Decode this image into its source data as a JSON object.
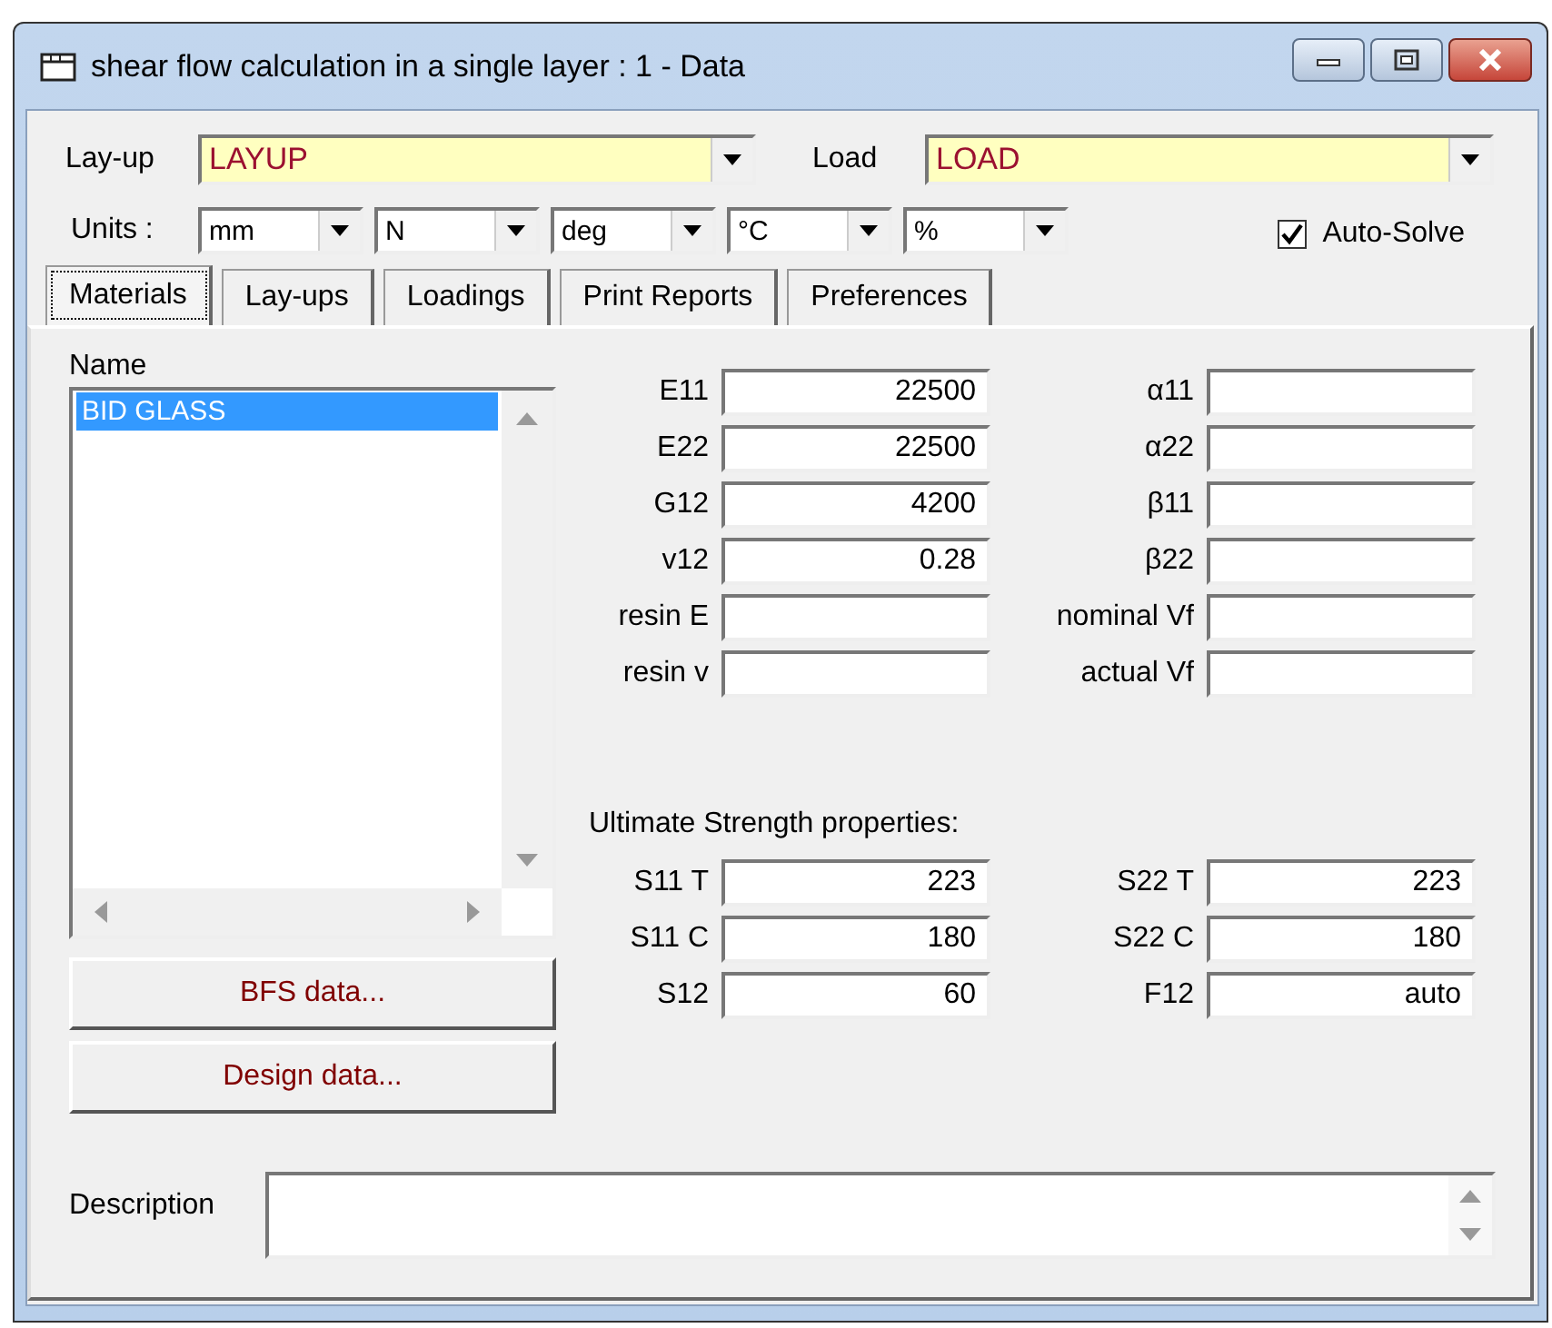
{
  "window": {
    "title": "shear flow calculation in a single layer : 1 - Data"
  },
  "window_buttons": [
    {
      "kind": "minimize"
    },
    {
      "kind": "maximize"
    },
    {
      "kind": "close"
    }
  ],
  "layup": {
    "label": "Lay-up",
    "value": "LAYUP"
  },
  "load": {
    "label": "Load",
    "value": "LOAD"
  },
  "units": {
    "label": "Units :",
    "options": [
      "mm",
      "N",
      "deg",
      "°C",
      "%"
    ]
  },
  "auto_solve": {
    "label": "Auto-Solve",
    "checked": true
  },
  "tabs": [
    {
      "label": "Materials",
      "selected": true
    },
    {
      "label": "Lay-ups",
      "selected": false
    },
    {
      "label": "Loadings",
      "selected": false
    },
    {
      "label": "Print Reports",
      "selected": false
    },
    {
      "label": "Preferences",
      "selected": false
    }
  ],
  "materials": {
    "label": "Name",
    "items": [
      {
        "name": "BID GLASS",
        "selected": true
      }
    ]
  },
  "buttons": [
    "BFS data...",
    "Design data..."
  ],
  "properties": [
    {
      "label": "E11",
      "value": "22500"
    },
    {
      "label": "α11"
    },
    {
      "label": "E22",
      "value": "22500"
    },
    {
      "label": "α22"
    },
    {
      "label": "G12",
      "value": "4200"
    },
    {
      "label": "β11"
    },
    {
      "label": "v12",
      "value": "0.28"
    },
    {
      "label": "β22"
    },
    {
      "label": "resin E"
    },
    {
      "label": "nominal Vf"
    },
    {
      "label": "resin v"
    },
    {
      "label": "actual Vf"
    }
  ],
  "strength_heading": "Ultimate Strength properties:",
  "strength": [
    {
      "label": "S11 T",
      "value": "223"
    },
    {
      "label": "S22 T",
      "value": "223"
    },
    {
      "label": "S11 C",
      "value": "180"
    },
    {
      "label": "S22 C",
      "value": "180"
    },
    {
      "label": "S12",
      "value": "60"
    },
    {
      "label": "F12",
      "value": "auto"
    }
  ],
  "description": {
    "label": "Description"
  }
}
